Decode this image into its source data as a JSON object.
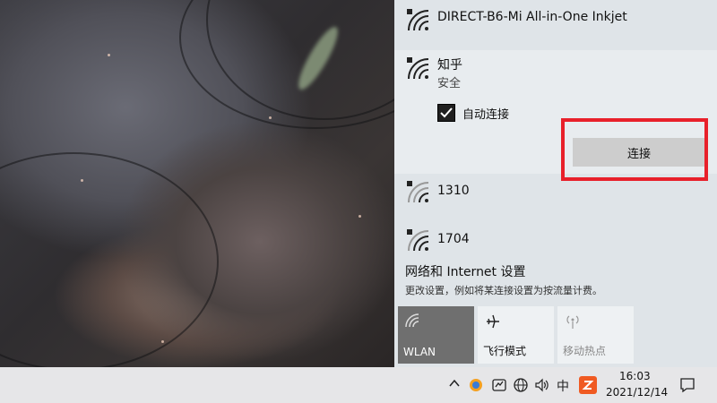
{
  "networks": [
    {
      "name": "DIRECT-B6-Mi All-in-One Inkjet"
    },
    {
      "name": "知乎",
      "status": "安全",
      "auto_connect_label": "自动连接",
      "auto_connect_checked": true,
      "connect_label": "连接"
    },
    {
      "name": "1310"
    },
    {
      "name": "1704"
    }
  ],
  "settings": {
    "title": "网络和 Internet 设置",
    "subtitle": "更改设置，例如将某连接设置为按流量计费。"
  },
  "quick_actions": [
    {
      "label": "WLAN",
      "icon": "wifi-icon",
      "active": true
    },
    {
      "label": "飞行模式",
      "icon": "airplane-icon",
      "active": false
    },
    {
      "label": "移动热点",
      "icon": "hotspot-icon",
      "active": false,
      "disabled": true
    }
  ],
  "taskbar": {
    "time": "16:03",
    "date": "2021/12/14",
    "ime": "中"
  },
  "colors": {
    "highlight": "#e8202a",
    "wlan_tile": "#6f6f6f",
    "panel": "#dfe4e8"
  }
}
